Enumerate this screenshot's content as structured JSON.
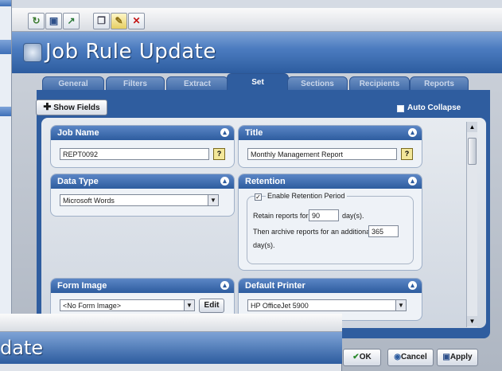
{
  "window": {
    "title": "Job Rule Update"
  },
  "toolbar": {
    "icons": [
      "refresh-icon",
      "save-icon",
      "export-icon",
      "copy-icon",
      "edit-icon",
      "delete-icon"
    ]
  },
  "tabs": [
    "General",
    "Filters",
    "Extract",
    "Set",
    "Sections",
    "Recipients",
    "Reports"
  ],
  "active_tab": "Set",
  "actions": {
    "show_fields": "Show Fields",
    "auto_collapse": "Auto Collapse"
  },
  "job_name": {
    "label": "Job Name",
    "value": "REPT0092"
  },
  "title_group": {
    "label": "Title",
    "value": "Monthly Management Report"
  },
  "data_type": {
    "label": "Data Type",
    "value": "Microsoft Words"
  },
  "retention": {
    "label": "Retention",
    "enable_label": "Enable Retention Period",
    "retain_label": "Retain reports for",
    "retain_value": "90",
    "retain_unit": "day(s).",
    "archive_label": "Then archive reports for an additional",
    "archive_value": "365",
    "archive_unit": "day(s)."
  },
  "form_image": {
    "label": "Form Image",
    "value": "<No Form Image>",
    "edit": "Edit"
  },
  "default_printer": {
    "label": "Default Printer",
    "value": "HP OfficeJet 5900"
  },
  "footer": {
    "ok": "OK",
    "cancel": "Cancel",
    "apply": "Apply"
  },
  "fg_window": {
    "title_partial": "date"
  },
  "colors": {
    "accent": "#2f5d9f",
    "title_gradient_top": "#7ea3d6"
  }
}
